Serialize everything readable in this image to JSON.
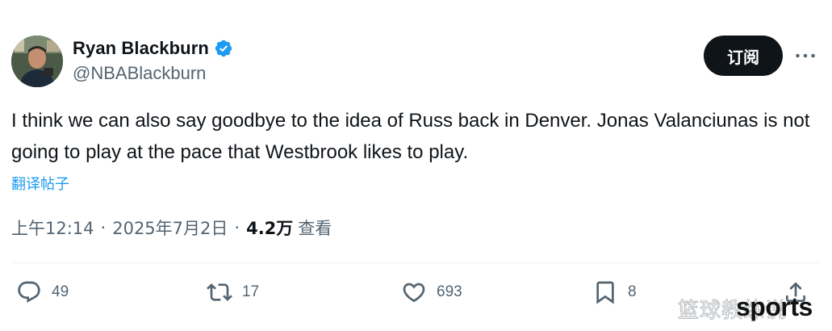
{
  "author": {
    "display_name": "Ryan Blackburn",
    "handle": "@NBABlackburn",
    "verified": true
  },
  "header": {
    "subscribe_label": "订阅",
    "more_icon": "more-horizontal-icon"
  },
  "tweet": {
    "text": "I think we can also say goodbye to the idea of Russ back in Denver. Jonas Valanciunas is not going to play at the pace that Westbrook likes to play.",
    "translate_label": "翻译帖子"
  },
  "meta": {
    "time": "上午12:14",
    "separator": "·",
    "date": "2025年7月2日",
    "views_count": "4.2万",
    "views_label": "查看"
  },
  "actions": {
    "replies": "49",
    "retweets": "17",
    "likes": "693",
    "bookmarks": "8"
  },
  "watermark": {
    "chinese": "篮球教练说",
    "english": "sports"
  },
  "colors": {
    "text_primary": "#0f1419",
    "text_secondary": "#536471",
    "link": "#1d9bf0",
    "verified": "#1d9bf0",
    "button_bg": "#0f1419"
  }
}
